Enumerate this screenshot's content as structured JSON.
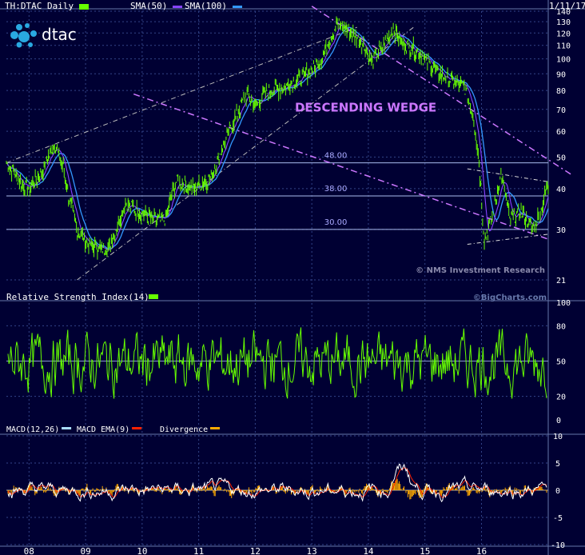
{
  "header": {
    "title": "TH:DTAC Daily",
    "sma50": "SMA(50)",
    "sma100": "SMA(100)",
    "date": "1/11/17"
  },
  "logo": {
    "text": "dtac"
  },
  "colors": {
    "background": "#000033",
    "price": "#66ff00",
    "sma50": "#8844ff",
    "sma100": "#3399ff",
    "wedge": "#cc77ff",
    "macd": "#ffffff",
    "macd_ema": "#ff2200",
    "divergence": "#ffaa00",
    "grid": "#334488"
  },
  "chart_data": [
    {
      "type": "line",
      "panel": "price",
      "title": "TH:DTAC Daily",
      "x_ticks": [
        "08",
        "09",
        "10",
        "11",
        "12",
        "13",
        "14",
        "15",
        "16"
      ],
      "y_scale": "log",
      "y_ticks": [
        140,
        130,
        120,
        110,
        100,
        90,
        80,
        70,
        60,
        50,
        40,
        30,
        21
      ],
      "ylim": [
        21,
        140
      ],
      "anchors": [
        [
          2007.6,
          48
        ],
        [
          2007.85,
          42
        ],
        [
          2008.0,
          40
        ],
        [
          2008.2,
          44
        ],
        [
          2008.45,
          55
        ],
        [
          2008.6,
          47
        ],
        [
          2008.7,
          38
        ],
        [
          2008.85,
          30
        ],
        [
          2009.05,
          27
        ],
        [
          2009.4,
          26
        ],
        [
          2009.7,
          36
        ],
        [
          2009.95,
          34
        ],
        [
          2010.2,
          32
        ],
        [
          2010.4,
          32
        ],
        [
          2010.6,
          42
        ],
        [
          2010.9,
          40
        ],
        [
          2011.2,
          43
        ],
        [
          2011.45,
          55
        ],
        [
          2011.65,
          66
        ],
        [
          2011.85,
          78
        ],
        [
          2012.0,
          72
        ],
        [
          2012.25,
          80
        ],
        [
          2012.5,
          82
        ],
        [
          2012.75,
          86
        ],
        [
          2013.0,
          92
        ],
        [
          2013.2,
          103
        ],
        [
          2013.45,
          128
        ],
        [
          2013.7,
          120
        ],
        [
          2013.9,
          112
        ],
        [
          2014.05,
          98
        ],
        [
          2014.25,
          108
        ],
        [
          2014.45,
          124
        ],
        [
          2014.6,
          112
        ],
        [
          2014.8,
          108
        ],
        [
          2015.0,
          100
        ],
        [
          2015.25,
          90
        ],
        [
          2015.5,
          85
        ],
        [
          2015.7,
          82
        ],
        [
          2015.85,
          68
        ],
        [
          2015.95,
          50
        ],
        [
          2016.05,
          28
        ],
        [
          2016.2,
          33
        ],
        [
          2016.35,
          45
        ],
        [
          2016.5,
          32
        ],
        [
          2016.7,
          34
        ],
        [
          2016.9,
          30
        ],
        [
          2017.05,
          34
        ],
        [
          2017.15,
          40
        ]
      ],
      "levels": [
        {
          "label": "48.00",
          "value": 48
        },
        {
          "label": "38.00",
          "value": 38
        },
        {
          "label": "30.00",
          "value": 30
        }
      ],
      "annotations": [
        "DESCENDING WEDGE",
        "© NMS Investment Research"
      ],
      "series": [
        {
          "name": "TH:DTAC Daily"
        },
        {
          "name": "SMA(50)"
        },
        {
          "name": "SMA(100)"
        }
      ]
    },
    {
      "type": "line",
      "panel": "rsi",
      "title": "Relative Strength Index(14)",
      "watermark": "©BigCharts.com",
      "y_ticks": [
        100,
        80,
        50,
        20,
        0
      ],
      "ylim": [
        0,
        100
      ],
      "series": [
        {
          "name": "Relative Strength Index(14)"
        }
      ]
    },
    {
      "type": "line",
      "panel": "macd",
      "y_ticks": [
        10,
        5,
        0,
        -5,
        -10
      ],
      "ylim": [
        -10,
        10
      ],
      "series": [
        {
          "name": "MACD(12,26)"
        },
        {
          "name": "MACD EMA(9)"
        },
        {
          "name": "Divergence"
        }
      ]
    }
  ]
}
